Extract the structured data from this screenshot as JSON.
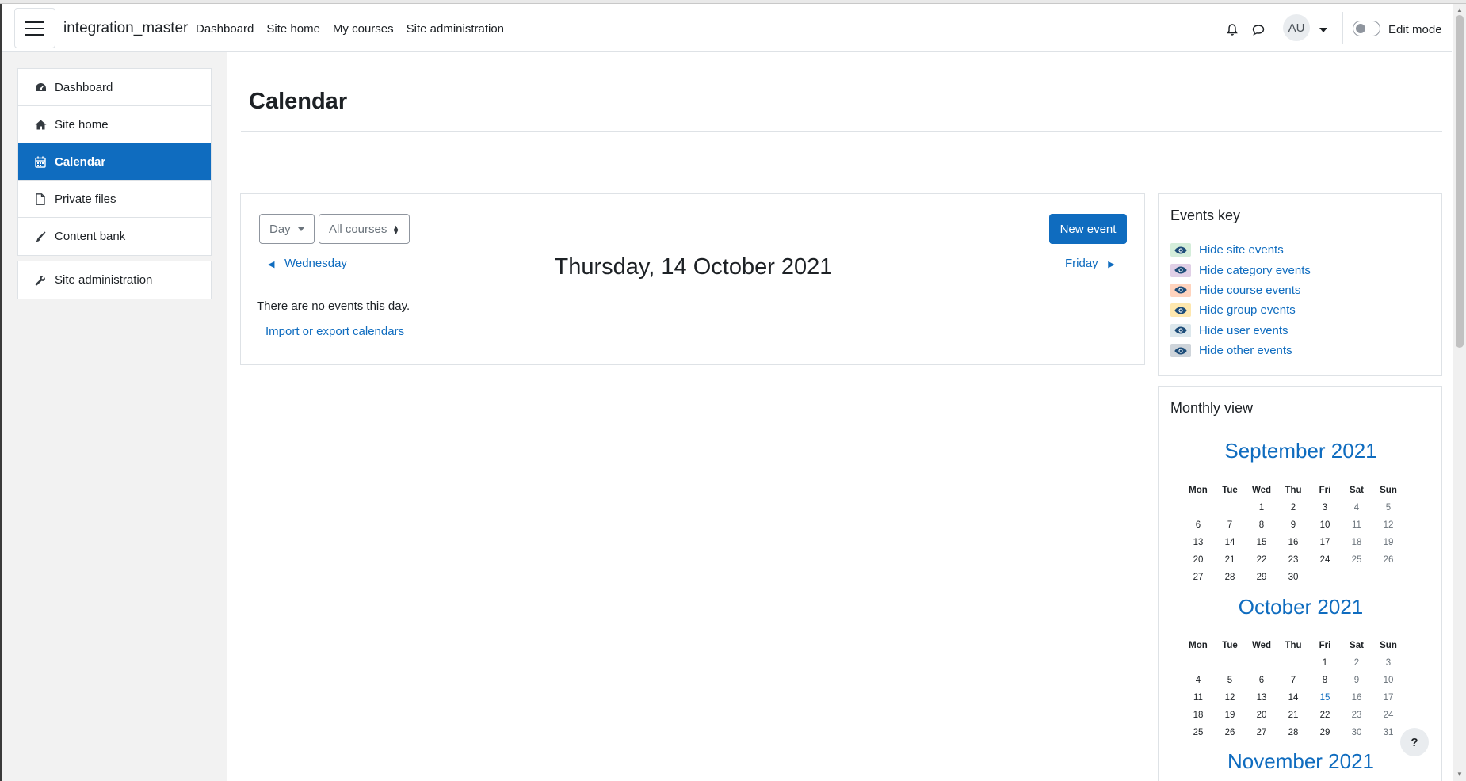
{
  "header": {
    "site_name": "integration_master",
    "nav": [
      "Dashboard",
      "Site home",
      "My courses",
      "Site administration"
    ],
    "user_initials": "AU",
    "edit_mode_label": "Edit mode",
    "edit_mode_on": false
  },
  "sidebar": {
    "items": [
      {
        "label": "Dashboard",
        "icon": "dashboard-icon"
      },
      {
        "label": "Site home",
        "icon": "home-icon"
      },
      {
        "label": "Calendar",
        "icon": "calendar-icon",
        "active": true
      },
      {
        "label": "Private files",
        "icon": "file-icon"
      },
      {
        "label": "Content bank",
        "icon": "paint-brush-icon"
      }
    ],
    "admin_item": {
      "label": "Site administration",
      "icon": "wrench-icon"
    }
  },
  "main": {
    "page_title": "Calendar",
    "view_select": "Day",
    "course_select": "All courses",
    "new_event_label": "New event",
    "prev_day_label": "Wednesday",
    "next_day_label": "Friday",
    "day_title": "Thursday, 14 October 2021",
    "no_events_text": "There are no events this day.",
    "import_export_label": "Import or export calendars"
  },
  "events_key": {
    "title": "Events key",
    "items": [
      {
        "label": "Hide site events",
        "color": "#d4edda"
      },
      {
        "label": "Hide category events",
        "color": "#e0cfe6"
      },
      {
        "label": "Hide course events",
        "color": "#ffd3bd"
      },
      {
        "label": "Hide group events",
        "color": "#fee7ae"
      },
      {
        "label": "Hide user events",
        "color": "#dce7ec"
      },
      {
        "label": "Hide other events",
        "color": "#ced4da"
      }
    ]
  },
  "monthly_view": {
    "title": "Monthly view",
    "weekday_headers": [
      "Mon",
      "Tue",
      "Wed",
      "Thu",
      "Fri",
      "Sat",
      "Sun"
    ],
    "months": [
      {
        "name": "September 2021",
        "weeks": [
          [
            "",
            "",
            "1",
            "2",
            "3",
            "4",
            "5"
          ],
          [
            "6",
            "7",
            "8",
            "9",
            "10",
            "11",
            "12"
          ],
          [
            "13",
            "14",
            "15",
            "16",
            "17",
            "18",
            "19"
          ],
          [
            "20",
            "21",
            "22",
            "23",
            "24",
            "25",
            "26"
          ],
          [
            "27",
            "28",
            "29",
            "30",
            "",
            "",
            ""
          ]
        ]
      },
      {
        "name": "October 2021",
        "today": "15",
        "weeks": [
          [
            "",
            "",
            "",
            "",
            "1",
            "2",
            "3"
          ],
          [
            "4",
            "5",
            "6",
            "7",
            "8",
            "9",
            "10"
          ],
          [
            "11",
            "12",
            "13",
            "14",
            "15",
            "16",
            "17"
          ],
          [
            "18",
            "19",
            "20",
            "21",
            "22",
            "23",
            "24"
          ],
          [
            "25",
            "26",
            "27",
            "28",
            "29",
            "30",
            "31"
          ]
        ]
      },
      {
        "name": "November 2021"
      }
    ]
  },
  "help_button_label": "?"
}
